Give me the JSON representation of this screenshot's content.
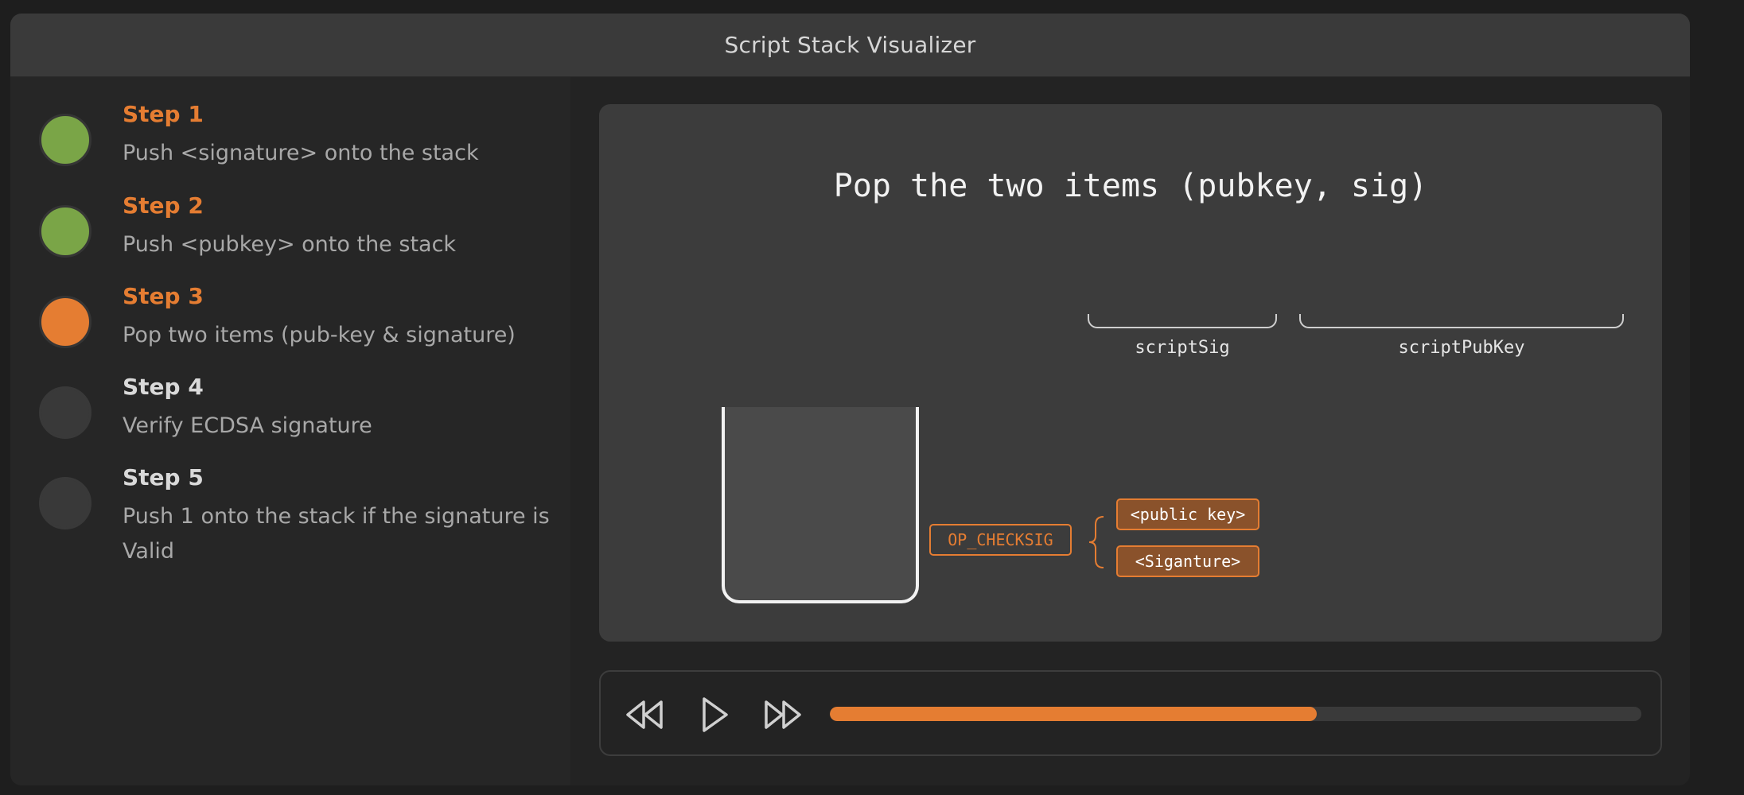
{
  "window": {
    "title": "Script Stack Visualizer"
  },
  "steps": [
    {
      "name": "Step 1",
      "description": "Push <signature> onto the stack",
      "status": "done"
    },
    {
      "name": "Step 2",
      "description": "Push <pubkey> onto the stack",
      "status": "done"
    },
    {
      "name": "Step 3",
      "description": "Pop two items (pub-key & signature)",
      "status": "active"
    },
    {
      "name": "Step 4",
      "description": "Verify ECDSA signature",
      "status": "pending"
    },
    {
      "name": "Step 5",
      "description": "Push 1 onto the stack if the signature is Valid",
      "status": "pending"
    }
  ],
  "stage": {
    "caption": "Pop the two items (pubkey, sig)",
    "script_sig_label": "scriptSig",
    "script_pubkey_label": "scriptPubKey",
    "opcode": "OP_CHECKSIG",
    "popped_items": [
      "<public key>",
      "<Siganture>"
    ]
  },
  "controls": {
    "rewind_icon": "rewind-icon",
    "play_icon": "play-icon",
    "fast_forward_icon": "fast-forward-icon",
    "progress": 0.6
  },
  "colors": {
    "accent": "#e57d32",
    "done": "#7aa547",
    "pending": "#393939"
  }
}
